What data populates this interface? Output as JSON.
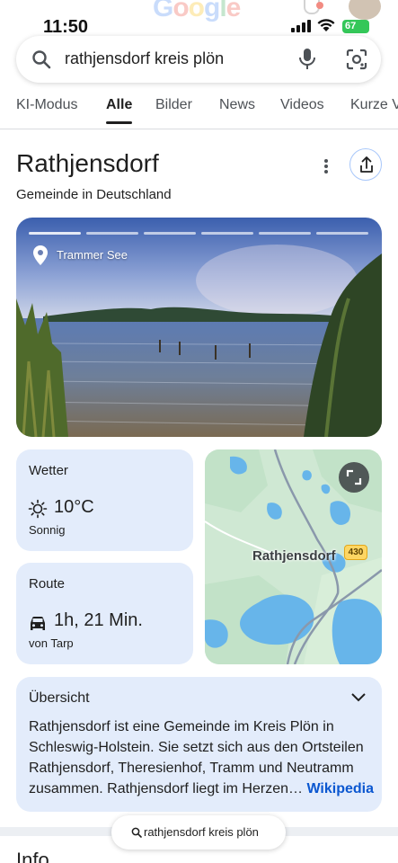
{
  "status": {
    "time": "11:50",
    "battery": "67"
  },
  "brand": {
    "logo_text": [
      "G",
      "o",
      "o",
      "g",
      "l",
      "e"
    ]
  },
  "search": {
    "query": "rathjensdorf kreis plön"
  },
  "tabs": [
    {
      "label": "KI-Modus",
      "active": false
    },
    {
      "label": "Alle",
      "active": true
    },
    {
      "label": "Bilder",
      "active": false
    },
    {
      "label": "News",
      "active": false
    },
    {
      "label": "Videos",
      "active": false
    },
    {
      "label": "Kurze V",
      "active": false
    }
  ],
  "panel": {
    "title": "Rathjensdorf",
    "subtitle": "Gemeinde in Deutschland",
    "photo_location": "Trammer See",
    "photo_count": 6,
    "photo_current": 1
  },
  "weather": {
    "title": "Wetter",
    "temp": "10°C",
    "condition": "Sonnig"
  },
  "route": {
    "title": "Route",
    "duration": "1h, 21 Min.",
    "from": "von Tarp"
  },
  "map": {
    "label": "Rathjensdorf",
    "road": "430"
  },
  "overview": {
    "title": "Übersicht",
    "text": "Rathjensdorf ist eine Gemeinde im Kreis Plön in Schleswig-Holstein. Sie setzt sich aus den Ortsteilen Rathjensdorf, Theresienhof, Tramm und Neutramm zusammen. Rathjensdorf liegt im Herzen",
    "ellipsis": "…",
    "source": "Wikipedia"
  },
  "info": {
    "title": "Info"
  },
  "chip": {
    "text": "rathjensdorf kreis plön"
  },
  "colors": {
    "card_bg": "#e3ecfb",
    "link": "#0b57d0",
    "battery": "#34c759"
  }
}
